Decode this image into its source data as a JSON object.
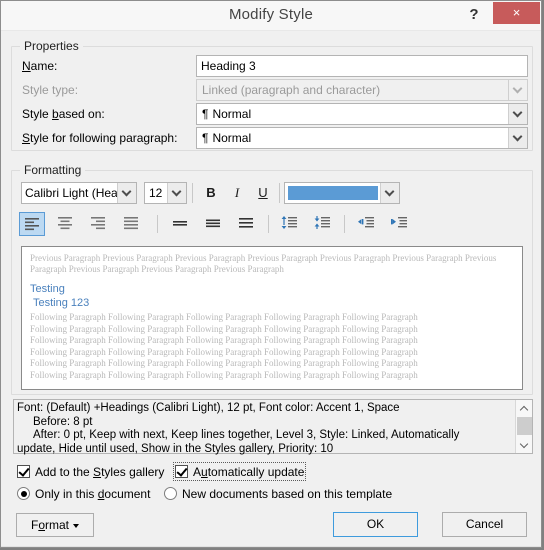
{
  "dialog": {
    "title": "Modify Style",
    "help_icon": "?",
    "close_icon": "×"
  },
  "properties": {
    "group_label": "Properties",
    "name_label": "Name:",
    "name_value": "Heading 3",
    "style_type_label": "Style type:",
    "style_type_value": "Linked (paragraph and character)",
    "style_based_on_label": "Style based on:",
    "style_based_on_value": "Normal",
    "style_following_label": "Style for following paragraph:",
    "style_following_value": "Normal",
    "pilcrow": "¶"
  },
  "formatting": {
    "group_label": "Formatting",
    "font_name": "Calibri Light (Head",
    "font_size": "12",
    "bold_label": "B",
    "italic_label": "I",
    "underline_label": "U",
    "font_color": "#5b9bd5",
    "accent_blue": "#5b9bd5",
    "selected_button_fill": "#bcd9f2",
    "align_buttons": [
      {
        "name": "align-left-button",
        "selected": true
      },
      {
        "name": "align-center-button",
        "selected": false
      },
      {
        "name": "align-right-button",
        "selected": false
      },
      {
        "name": "align-justify-button",
        "selected": false
      }
    ],
    "line_spacing_buttons": [
      {
        "name": "line-spacing-single-button"
      },
      {
        "name": "line-spacing-1-5-button"
      },
      {
        "name": "line-spacing-double-button"
      }
    ],
    "paragraph_spacing_buttons": [
      {
        "name": "increase-paragraph-spacing-button"
      },
      {
        "name": "decrease-paragraph-spacing-button"
      }
    ],
    "indent_buttons": [
      {
        "name": "decrease-indent-button"
      },
      {
        "name": "increase-indent-button"
      }
    ]
  },
  "preview": {
    "previous_paragraph": "Previous Paragraph Previous Paragraph Previous Paragraph Previous Paragraph Previous Paragraph Previous Paragraph Previous Paragraph Previous Paragraph Previous Paragraph Previous Paragraph",
    "heading_line_1": "Testing",
    "heading_line_2": "Testing 123",
    "following_paragraph_line": "Following Paragraph Following Paragraph Following Paragraph Following Paragraph Following Paragraph",
    "following_line_count": 6
  },
  "description": {
    "line1": "Font: (Default) +Headings (Calibri Light), 12 pt, Font color: Accent 1, Space",
    "line2": "Before:  8 pt",
    "line3": "After:  0 pt, Keep with next, Keep lines together, Level 3, Style: Linked, Automatically",
    "line4": "update, Hide until used, Show in the Styles gallery, Priority: 10"
  },
  "options": {
    "add_to_gallery_label": "Add to the Styles gallery",
    "add_to_gallery_checked": true,
    "auto_update_label": "Automatically update",
    "auto_update_checked": true,
    "auto_update_focused": true,
    "only_this_document_label": "Only in this document",
    "only_this_document_selected": true,
    "new_documents_label": "New documents based on this template",
    "new_documents_selected": false
  },
  "buttons": {
    "format_label": "Format",
    "ok_label": "OK",
    "cancel_label": "Cancel"
  }
}
